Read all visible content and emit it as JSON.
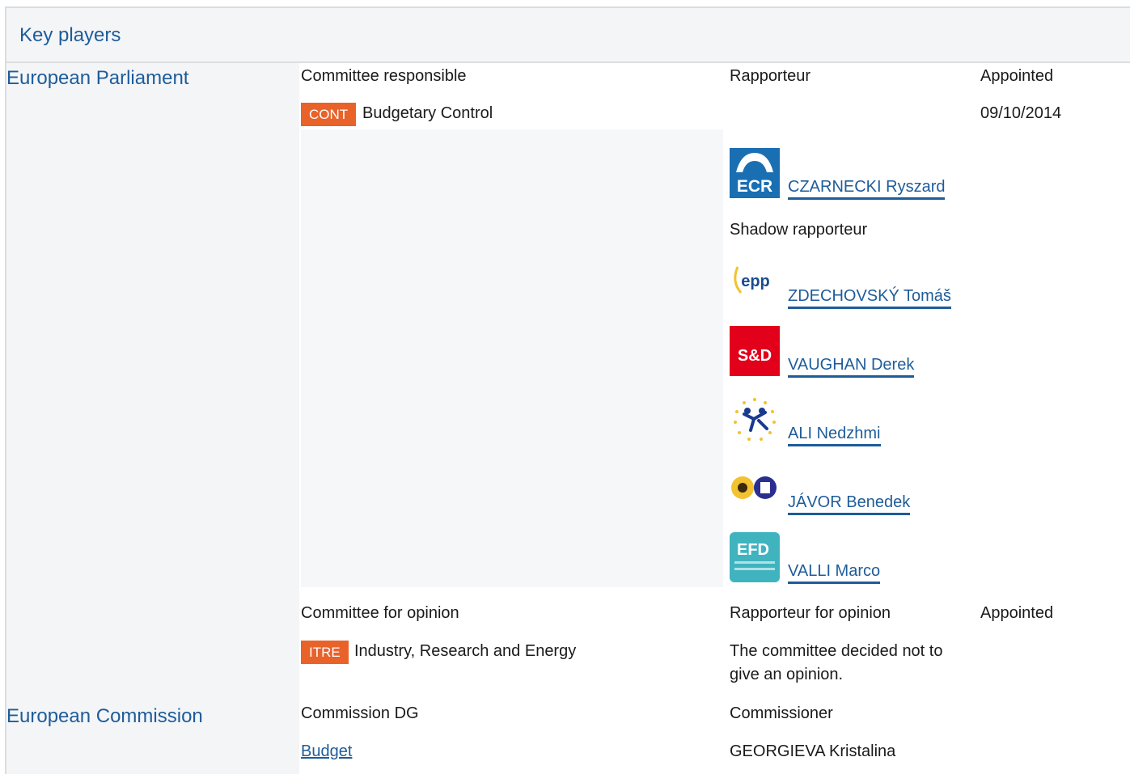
{
  "header": {
    "title": "Key players"
  },
  "parliament": {
    "institution": "European Parliament",
    "committee_responsible": {
      "col_committee": "Committee responsible",
      "col_rapporteur": "Rapporteur",
      "col_appointed": "Appointed",
      "badge": "CONT",
      "name": "Budgetary Control",
      "appointed": "09/10/2014",
      "rapporteur": {
        "group_icon": "ecr-logo-icon",
        "name": "CZARNECKI Ryszard"
      },
      "shadow_label": "Shadow rapporteur",
      "shadows": [
        {
          "group_icon": "epp-logo-icon",
          "name": "ZDECHOVSKÝ Tomáš"
        },
        {
          "group_icon": "sd-logo-icon",
          "name": "VAUGHAN Derek"
        },
        {
          "group_icon": "alde-logo-icon",
          "name": "ALI Nedzhmi"
        },
        {
          "group_icon": "greens-efa-logo-icon",
          "name": "JÁVOR Benedek"
        },
        {
          "group_icon": "efdd-logo-icon",
          "name": "VALLI Marco"
        }
      ]
    },
    "committee_opinion": {
      "col_committee": "Committee for opinion",
      "col_rapporteur": "Rapporteur for opinion",
      "col_appointed": "Appointed",
      "badge": "ITRE",
      "name": "Industry, Research and Energy",
      "note": "The committee decided not to give an opinion."
    }
  },
  "commission": {
    "institution": "European Commission",
    "col_dg": "Commission DG",
    "col_commissioner": "Commissioner",
    "dg": "Budget",
    "commissioner": "GEORGIEVA Kristalina"
  },
  "colors": {
    "accent": "#1e5c9a",
    "badge": "#e8622a",
    "panel": "#f4f5f7"
  }
}
